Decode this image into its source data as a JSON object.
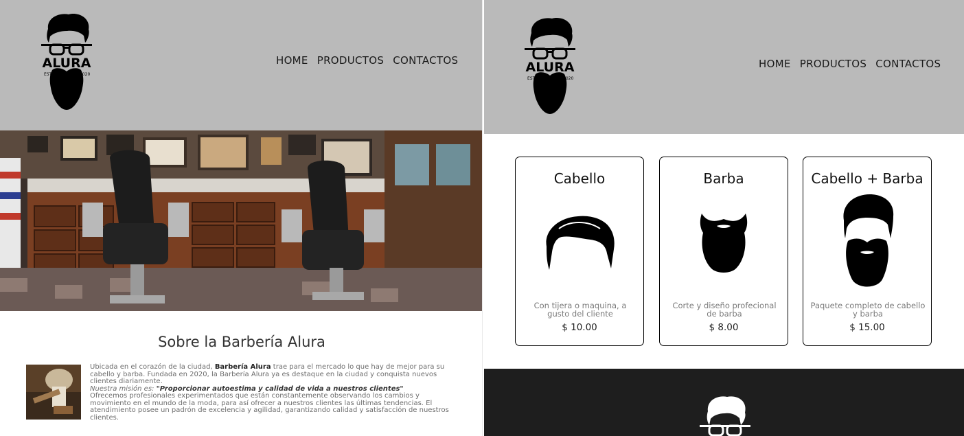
{
  "left_page": {
    "logo": {
      "icon": "barber-logo-icon",
      "brand": "ALURA",
      "estd": "ESTD",
      "year": "2020"
    },
    "nav": {
      "home": "HOME",
      "products": "PRODUCTOS",
      "contacts": "CONTACTOS"
    },
    "banner": {
      "icon": "barbershop-interior-image"
    },
    "about": {
      "title": "Sobre la Barbería Alura",
      "p1_a": "Ubicada en el corazón de la ciudad, ",
      "p1_brand": "Barbería Alura",
      "p1_b": " trae para el mercado lo que hay de mejor para su cabello y barba. Fundada en 2020, la Barbería Alura ya es destaque en la ciudad y conquista nuevos clientes diariamente.",
      "mission_label": "Nuestra misión es: ",
      "mission_quote": "\"Proporcionar autoestima y calidad de vida a nuestros clientes\"",
      "p2": "Ofrecemos profesionales experimentados que están constantemente observando los cambios y movimiento en el mundo de la moda, para así ofrecer a nuestros clientes las últimas tendencias. El atendimiento posee un padrón de excelencia y agilidad, garantizando calidad y satisfacción de nuestros clientes."
    }
  },
  "right_page": {
    "logo": {
      "icon": "barber-logo-icon",
      "brand": "ALURA",
      "estd": "ESTD",
      "year": "2020"
    },
    "nav": {
      "home": "HOME",
      "products": "PRODUCTOS",
      "contacts": "CONTACTOS"
    },
    "products": [
      {
        "title": "Cabello",
        "icon": "hair-icon",
        "description": "Con tijera o maquina, a gusto del cliente",
        "price": "$ 10.00"
      },
      {
        "title": "Barba",
        "icon": "beard-icon",
        "description": "Corte y diseño profecional de barba",
        "price": "$ 8.00"
      },
      {
        "title": "Cabello + Barba",
        "icon": "hair-and-beard-icon",
        "description": "Paquete completo de cabello y barba",
        "price": "$ 15.00"
      }
    ],
    "footer": {
      "icon": "barber-logo-icon"
    }
  },
  "colors": {
    "header_bg": "#bababa",
    "footer_bg": "#1e1e1e",
    "text": "#000000"
  }
}
